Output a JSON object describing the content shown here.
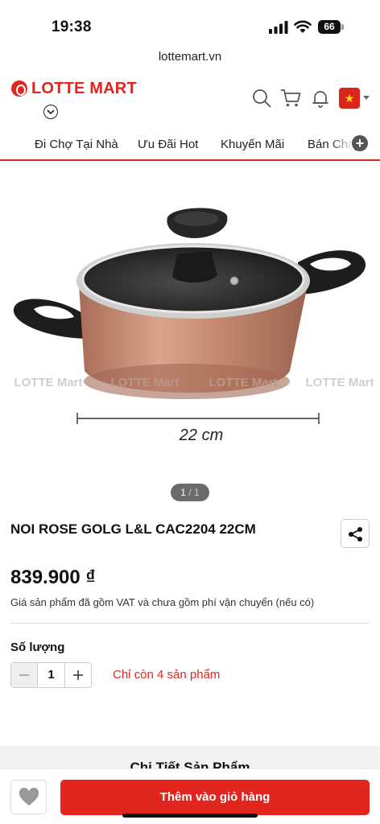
{
  "status_bar": {
    "time": "19:38",
    "battery": "66"
  },
  "browser": {
    "url": "lottemart.vn"
  },
  "header": {
    "logo_text": "LOTTE MART",
    "icons": [
      "search-icon",
      "cart-icon",
      "bell-icon",
      "vietnam-flag-icon"
    ]
  },
  "nav": {
    "items": [
      "Đi Chợ Tại Nhà",
      "Ưu Đãi Hot",
      "Khuyến Mãi",
      "Bán Chạy"
    ]
  },
  "gallery": {
    "watermark": "LOTTE Mart",
    "dimension_label": "22 cm",
    "current": "1",
    "separator": " / ",
    "total": "1"
  },
  "product": {
    "title": "NOI ROSE GOLG L&L CAC2204 22CM",
    "price": "839.900 ₫",
    "price_note": "Giá sản phẩm đã gồm VAT và chưa gồm phí vận chuyển (nếu có)",
    "quantity_label": "Số lượng",
    "quantity": "1",
    "stock_note": "Chỉ còn 4 sản phẩm"
  },
  "details": {
    "title": "Chi Tiết Sản Phẩm"
  },
  "bottom_bar": {
    "add_to_cart": "Thêm vào giỏ hàng"
  },
  "colors": {
    "brand": "#e0261f",
    "pot": "#c98a6e"
  }
}
